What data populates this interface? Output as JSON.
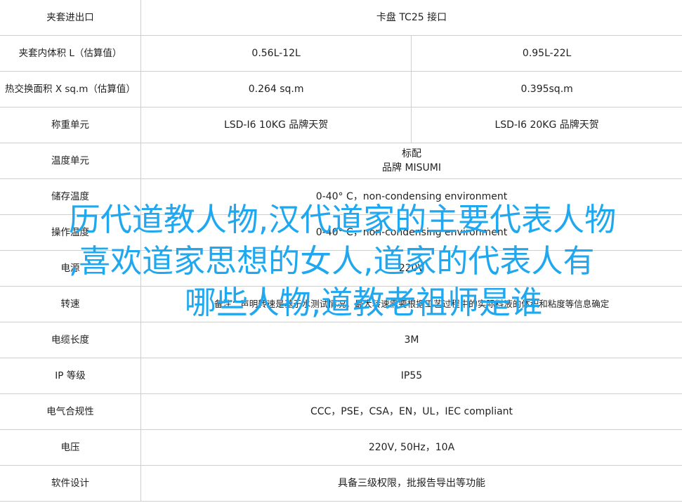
{
  "rows": [
    {
      "label": "夹套进出口",
      "span": true,
      "value": "卡盘 TC25 接口"
    },
    {
      "label": "夹套内体积 L（估算值）",
      "span": false,
      "left": "0.56L-12L",
      "right": "0.95L-22L"
    },
    {
      "label": "热交换面积 X sq.m（估算值）",
      "span": false,
      "left": "0.264 sq.m",
      "right": "0.395sq.m"
    },
    {
      "label": "称重单元",
      "span": false,
      "left": "LSD-I6 10KG 品牌天贺",
      "right": "LSD-I6 20KG 品牌天贺"
    },
    {
      "label": "温度单元",
      "span": true,
      "value": "标配",
      "value2": "品牌 MISUMI"
    },
    {
      "label": "储存温度",
      "span": true,
      "value": "0-40° C，non-condensing environment"
    },
    {
      "label": "操作温度",
      "span": true,
      "value": "0-40° C，non-condensing environment"
    },
    {
      "label": "电源",
      "span": true,
      "value": "220V"
    },
    {
      "label": "转速",
      "span": true,
      "value": "备注：声明转速是基于水测试情况。最大转速需要根据工艺过程中的实际料液的体积和粘度等信息确定"
    },
    {
      "label": "电缆长度",
      "span": true,
      "value": "3M"
    },
    {
      "label": "IP 等级",
      "span": true,
      "value": "IP55"
    },
    {
      "label": "电气合规性",
      "span": true,
      "value": "CCC，PSE，CSA，EN，UL，IEC compliant"
    },
    {
      "label": "电压",
      "span": true,
      "value": "220V, 50Hz，10A"
    },
    {
      "label": "软件设计",
      "span": true,
      "value": "具备三级权限，批报告导出等功能"
    }
  ],
  "overlay": {
    "line1": "历代道教人物,汉代道家的主要代表人物",
    "line2": ",喜欢道家思想的女人,道家的代表人有",
    "line3": "哪些人物,道教老祖师是谁"
  },
  "colors": {
    "overlay_text": "#1fa8ef",
    "grid_line": "#cfcfcf",
    "text": "#222222"
  }
}
